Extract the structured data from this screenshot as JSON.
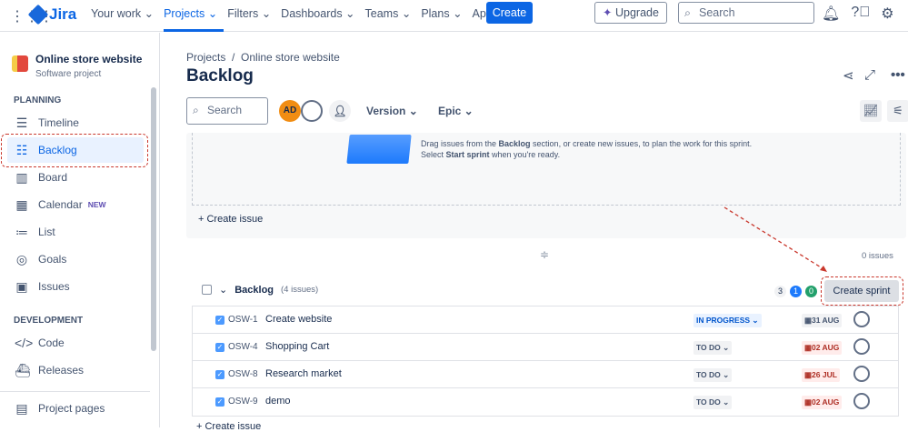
{
  "nav": {
    "items": [
      "Your work",
      "Projects",
      "Filters",
      "Dashboards",
      "Teams",
      "Plans",
      "Apps"
    ],
    "active": "Projects",
    "product": "Jira",
    "create": "Create",
    "upgrade": "Upgrade",
    "search_placeholder": "Search"
  },
  "sidebar": {
    "project_name": "Online store website",
    "project_type": "Software project",
    "planning_label": "PLANNING",
    "planning": [
      {
        "label": "Timeline",
        "icon": "timeline-icon"
      },
      {
        "label": "Backlog",
        "icon": "backlog-icon"
      },
      {
        "label": "Board",
        "icon": "board-icon"
      },
      {
        "label": "Calendar",
        "icon": "calendar-icon",
        "badge": "NEW"
      },
      {
        "label": "List",
        "icon": "list-icon"
      },
      {
        "label": "Goals",
        "icon": "goals-icon"
      },
      {
        "label": "Issues",
        "icon": "issues-icon"
      }
    ],
    "development_label": "DEVELOPMENT",
    "development": [
      {
        "label": "Code"
      },
      {
        "label": "Releases"
      }
    ],
    "project_pages": "Project pages"
  },
  "main": {
    "breadcrumb": [
      "Projects",
      "Online store website"
    ],
    "title": "Backlog",
    "search_placeholder": "Search",
    "avatar_initials": "AD",
    "version": "Version",
    "epic": "Epic",
    "sprint_msg_1a": "Drag issues from the ",
    "sprint_msg_1b": "Backlog",
    "sprint_msg_1c": " section, or create new issues, to plan the work for this sprint.",
    "sprint_msg_2a": "Select ",
    "sprint_msg_2b": "Start sprint",
    "sprint_msg_2c": " when you're ready.",
    "create_issue": "Create issue",
    "sprint_count": "0 issues",
    "backlog": {
      "title": "Backlog",
      "count": "(4 issues)",
      "todo": "3",
      "inprogress": "1",
      "done": "0",
      "create_sprint": "Create sprint",
      "issues": [
        {
          "key": "OSW-1",
          "summary": "Create website",
          "status": "IN PROGRESS",
          "due": "31 AUG",
          "late": false
        },
        {
          "key": "OSW-4",
          "summary": "Shopping Cart",
          "status": "TO DO",
          "due": "02 AUG",
          "late": true
        },
        {
          "key": "OSW-8",
          "summary": "Research market",
          "status": "TO DO",
          "due": "26 JUL",
          "late": true
        },
        {
          "key": "OSW-9",
          "summary": "demo",
          "status": "TO DO",
          "due": "02 AUG",
          "late": true
        }
      ]
    },
    "bottom_create": "Create issue"
  }
}
